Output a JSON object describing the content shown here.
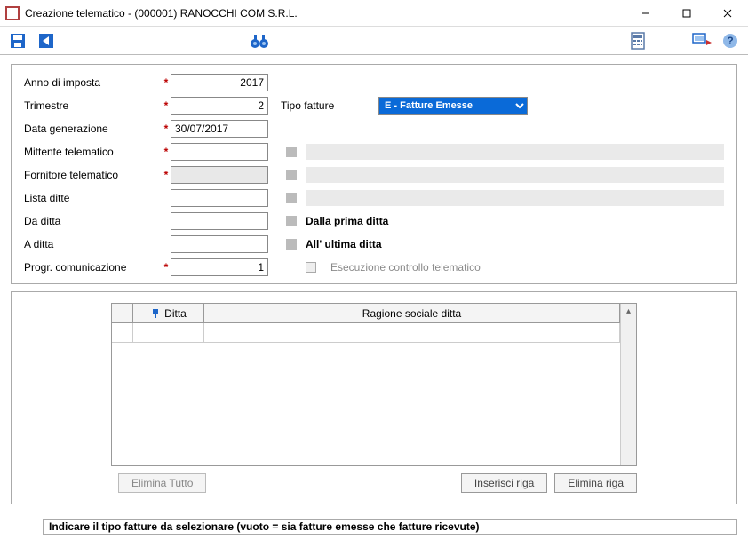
{
  "window": {
    "title": "Creazione telematico  -   (000001) RANOCCHI COM S.R.L."
  },
  "form": {
    "anno_label": "Anno di imposta",
    "anno_value": "2017",
    "trimestre_label": "Trimestre",
    "trimestre_value": "2",
    "data_gen_label": "Data generazione",
    "data_gen_value": "30/07/2017",
    "mittente_label": "Mittente telematico",
    "mittente_value": "",
    "fornitore_label": "Fornitore telematico",
    "fornitore_value": "",
    "lista_label": "Lista ditte",
    "lista_value": "",
    "da_ditta_label": "Da ditta",
    "da_ditta_value": "",
    "da_ditta_desc": "Dalla prima ditta",
    "a_ditta_label": "A ditta",
    "a_ditta_value": "",
    "a_ditta_desc": "All' ultima ditta",
    "progr_label": "Progr. comunicazione",
    "progr_value": "1",
    "tipo_label": "Tipo fatture",
    "tipo_value": "E  - Fatture Emesse",
    "esecuzione_label": "Esecuzione controllo telematico"
  },
  "grid": {
    "col1": "Ditta",
    "col2": "Ragione sociale ditta"
  },
  "buttons": {
    "elimina_tutto_prefix": "Elimina ",
    "elimina_tutto_u": "T",
    "elimina_tutto_suffix": "utto",
    "inserisci_u": "I",
    "inserisci_suffix": "nserisci riga",
    "elimina_riga_u": "E",
    "elimina_riga_suffix": "limina riga"
  },
  "status": {
    "text": "Indicare il tipo fatture da selezionare (vuoto = sia fatture emesse che fatture ricevute)"
  }
}
